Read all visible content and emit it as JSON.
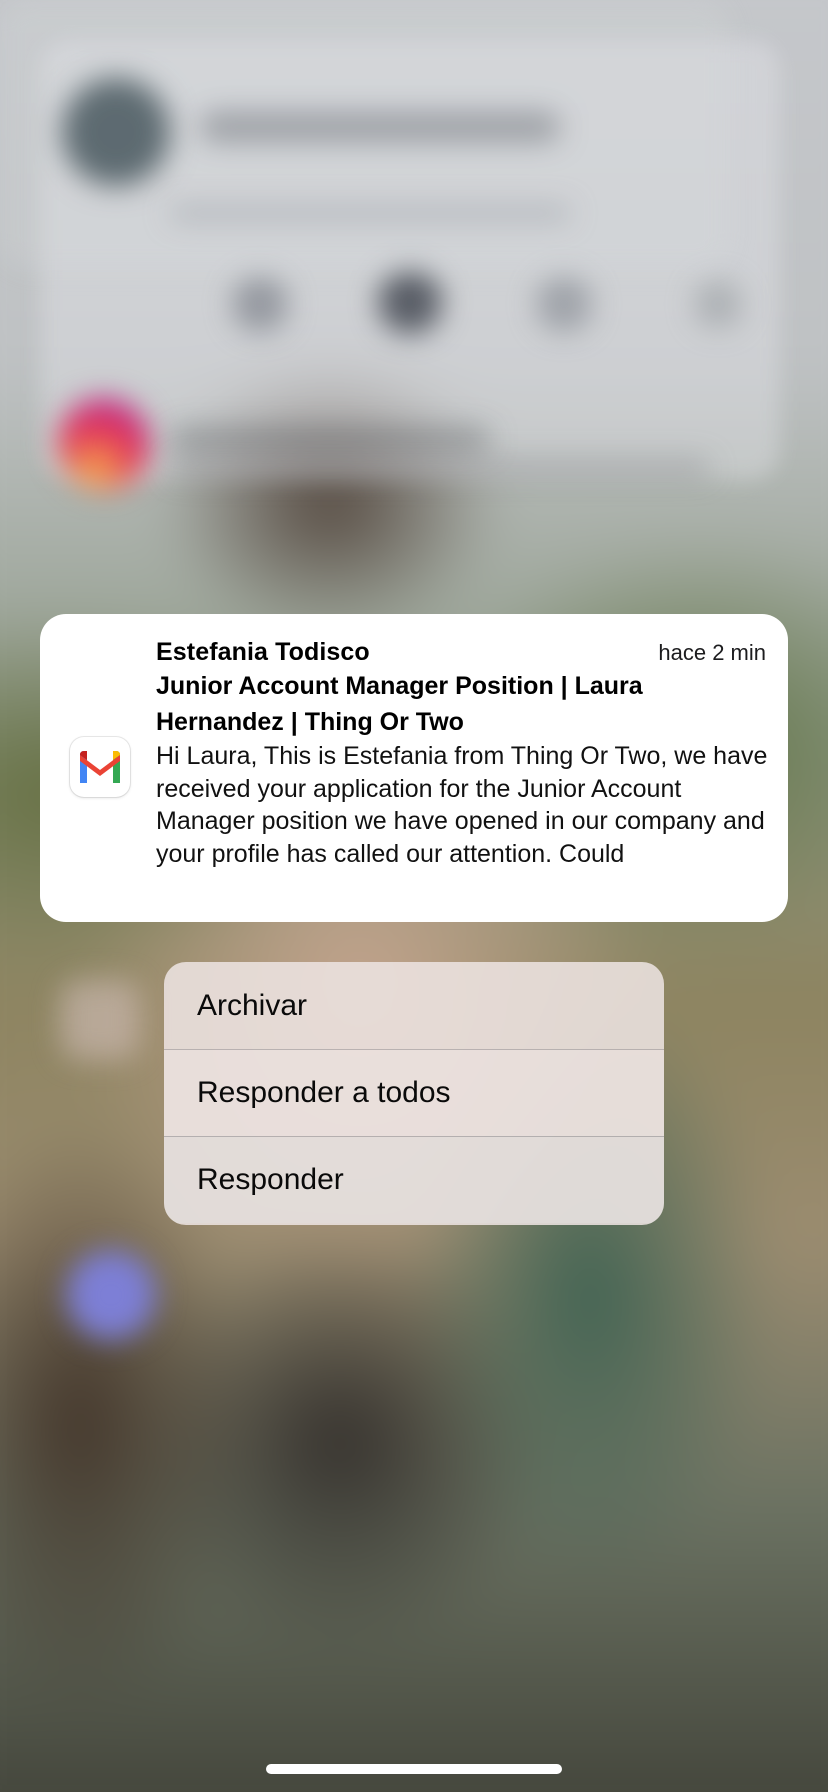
{
  "notification": {
    "app_icon": "gmail-icon",
    "sender": "Estefania Todisco",
    "time": "hace 2 min",
    "subject": "Junior Account Manager Position | Laura Hernandez | Thing Or Two",
    "preview": "Hi Laura, This is Estefania from Thing Or Two, we have received your application for the Junior Account Manager position we have opened in our company and your profile has called our attention. Could"
  },
  "context_menu": {
    "items": [
      {
        "label": "Archivar"
      },
      {
        "label": "Responder a todos"
      },
      {
        "label": "Responder"
      }
    ]
  },
  "colors": {
    "gmail_red": "#EA4335",
    "gmail_blue": "#4285F4",
    "gmail_green": "#34A853",
    "gmail_yellow": "#FBBC04",
    "gmail_dark_red": "#C5221F"
  }
}
